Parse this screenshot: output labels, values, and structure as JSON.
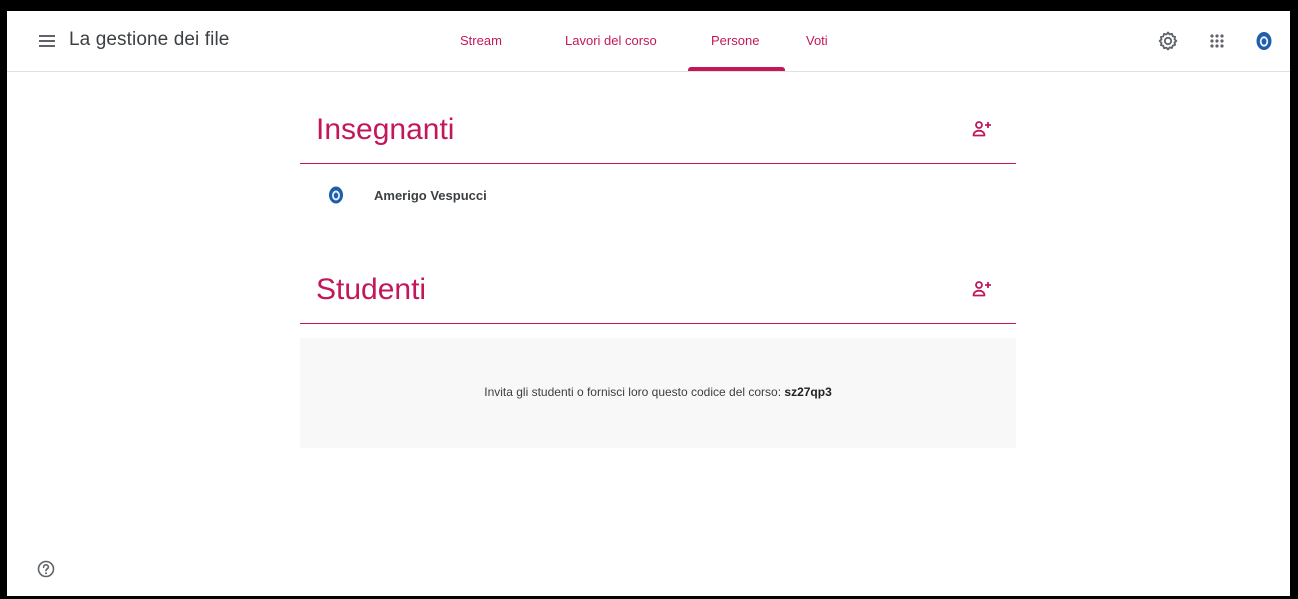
{
  "header": {
    "menu_icon": "hamburger-menu-icon",
    "class_title": "La gestione dei file",
    "tabs": [
      {
        "label": "Stream",
        "active": false
      },
      {
        "label": "Lavori del corso",
        "active": false
      },
      {
        "label": "Persone",
        "active": true
      },
      {
        "label": "Voti",
        "active": false
      }
    ],
    "icons": [
      "gear-icon",
      "apps-grid-icon",
      "account-avatar-icon"
    ]
  },
  "teachers": {
    "title": "Insegnanti",
    "add_icon": "person-add-icon",
    "list": [
      {
        "name": "Amerigo Vespucci",
        "avatar": "account-avatar-icon"
      }
    ]
  },
  "students": {
    "title": "Studenti",
    "add_icon": "person-add-icon",
    "invite_text": "Invita gli studenti o fornisci loro questo codice del corso:",
    "course_code": "sz27qp3"
  },
  "footer": {
    "help_icon": "help-icon"
  },
  "colors": {
    "accent": "#c2185b",
    "text": "#3c4043",
    "invite_bg": "#f8f8f8",
    "avatar_blue": "#1f5fa8"
  }
}
